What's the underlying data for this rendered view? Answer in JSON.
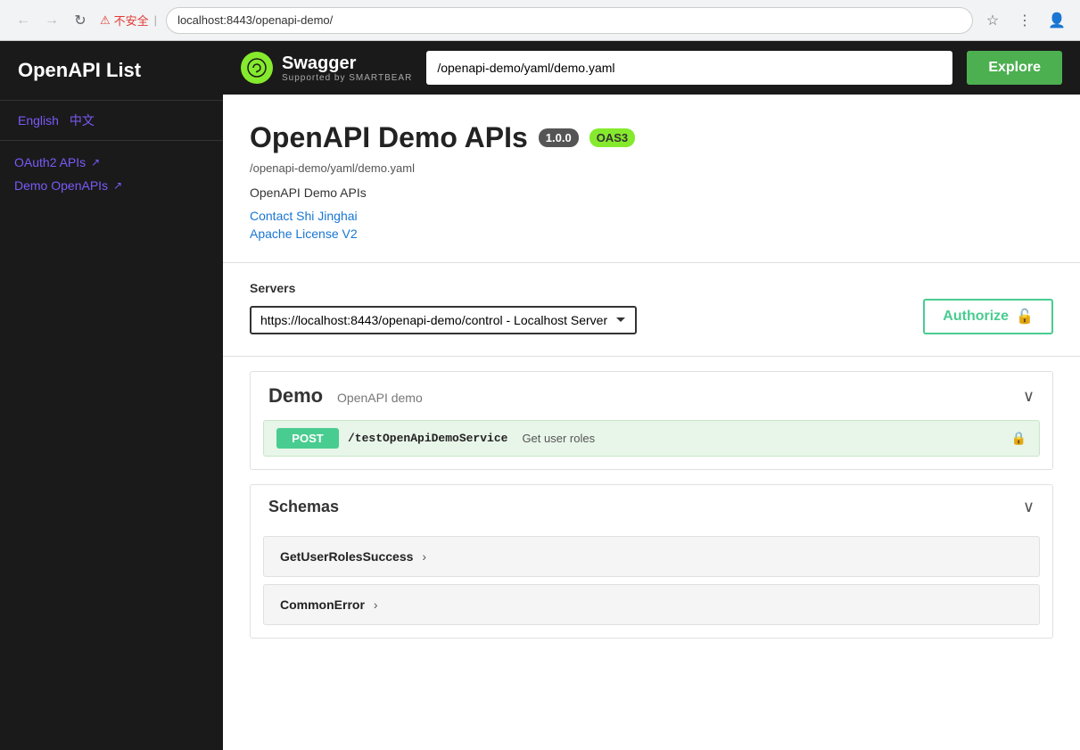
{
  "browser": {
    "back_disabled": true,
    "forward_disabled": true,
    "security_warning": "不安全",
    "address": "localhost:8443/openapi-demo/",
    "nav_back": "←",
    "nav_forward": "→",
    "nav_reload": "↻"
  },
  "sidebar": {
    "title": "OpenAPI List",
    "lang_english": "English",
    "lang_chinese": "中文",
    "links": [
      {
        "label": "OAuth2 APIs",
        "id": "oauth2-apis"
      },
      {
        "label": "Demo OpenAPIs",
        "id": "demo-openapis"
      }
    ]
  },
  "swagger_header": {
    "logo_letter": "⟳",
    "name": "Swagger",
    "supported_by": "Supported by SMARTBEAR",
    "url_value": "/openapi-demo/yaml/demo.yaml",
    "explore_label": "Explore"
  },
  "api_info": {
    "title": "OpenAPI Demo APIs",
    "version_badge": "1.0.0",
    "oas_badge": "OAS3",
    "path": "/openapi-demo/yaml/demo.yaml",
    "description": "OpenAPI Demo APIs",
    "contact_link": "Contact Shi Jinghai",
    "license_link": "Apache License V2"
  },
  "servers": {
    "label": "Servers",
    "selected_option": "https://localhost:8443/openapi-demo/control - Localhost Server",
    "options": [
      "https://localhost:8443/openapi-demo/control - Localhost Server"
    ],
    "authorize_label": "Authorize",
    "lock_icon": "🔓"
  },
  "demo_section": {
    "title": "Demo",
    "subtitle": "OpenAPI demo",
    "chevron": "∨",
    "endpoint": {
      "method": "POST",
      "path": "/testOpenApiDemoService",
      "description": "Get user roles",
      "lock_icon": "🔒"
    }
  },
  "schemas_section": {
    "title": "Schemas",
    "chevron": "∨",
    "items": [
      {
        "name": "GetUserRolesSuccess",
        "arrow": "›"
      },
      {
        "name": "CommonError",
        "arrow": "›"
      }
    ]
  }
}
